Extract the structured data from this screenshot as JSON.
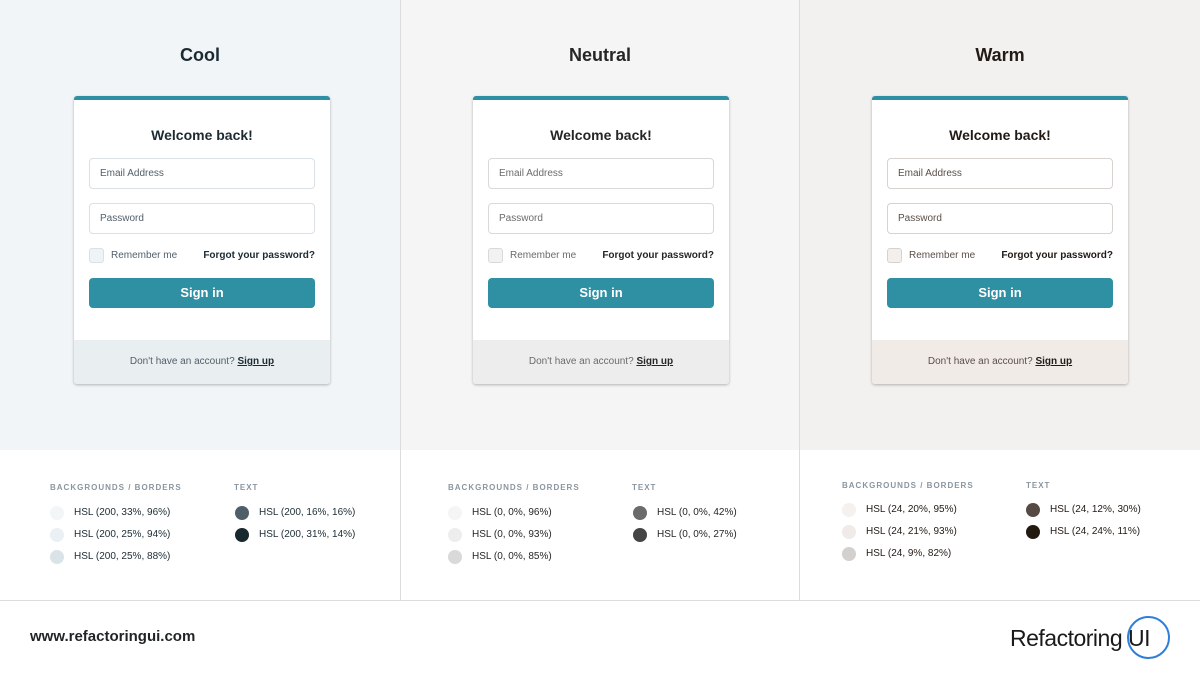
{
  "columns": {
    "cool": {
      "title": "Cool",
      "colors": {
        "page_bg": "#f1f5f8",
        "input_border": "#d9e1e6",
        "footer_bg": "#e9eef1",
        "checkbox_bg": "#eef3f6",
        "text_primary": "#1c2b33",
        "text_secondary": "#52606b"
      },
      "card": {
        "title": "Welcome back!",
        "email_placeholder": "Email Address",
        "password_placeholder": "Password",
        "remember_label": "Remember me",
        "forgot_label": "Forgot your password?",
        "signin_label": "Sign in",
        "footer_text": "Don't have an account?",
        "signup_label": "Sign up"
      },
      "legend": {
        "bg_heading": "BACKGROUNDS / BORDERS",
        "text_heading": "TEXT",
        "bg_swatches": [
          {
            "label": "HSL (200, 33%, 96%)",
            "color": "#f2f6f8"
          },
          {
            "label": "HSL (200, 25%, 94%)",
            "color": "#eaf0f3"
          },
          {
            "label": "HSL (200, 25%, 88%)",
            "color": "#d9e3e8"
          }
        ],
        "text_swatches": [
          {
            "label": "HSL (200, 16%, 16%)",
            "color": "#4d5f69"
          },
          {
            "label": "HSL (200, 31%, 14%)",
            "color": "#18282f"
          }
        ]
      }
    },
    "neutral": {
      "title": "Neutral",
      "colors": {
        "page_bg": "#f5f5f5",
        "input_border": "#d9d9d9",
        "footer_bg": "#ededed",
        "checkbox_bg": "#f2f2f2",
        "text_primary": "#262626",
        "text_secondary": "#6b6b6b"
      },
      "card": {
        "title": "Welcome back!",
        "email_placeholder": "Email Address",
        "password_placeholder": "Password",
        "remember_label": "Remember me",
        "forgot_label": "Forgot your password?",
        "signin_label": "Sign in",
        "footer_text": "Don't have an account?",
        "signup_label": "Sign up"
      },
      "legend": {
        "bg_heading": "BACKGROUNDS / BORDERS",
        "text_heading": "TEXT",
        "bg_swatches": [
          {
            "label": "HSL (0, 0%, 96%)",
            "color": "#f5f5f5"
          },
          {
            "label": "HSL (0, 0%, 93%)",
            "color": "#ededed"
          },
          {
            "label": "HSL (0, 0%, 85%)",
            "color": "#d9d9d9"
          }
        ],
        "text_swatches": [
          {
            "label": "HSL (0, 0%, 42%)",
            "color": "#6b6b6b"
          },
          {
            "label": "HSL (0, 0%, 27%)",
            "color": "#454545"
          }
        ]
      }
    },
    "warm": {
      "title": "Warm",
      "colors": {
        "page_bg": "#f3f1ef",
        "input_border": "#d7d2ce",
        "footer_bg": "#f1ebe8",
        "checkbox_bg": "#f3efec",
        "text_primary": "#221a15",
        "text_secondary": "#5a4f48"
      },
      "card": {
        "title": "Welcome back!",
        "email_placeholder": "Email Address",
        "password_placeholder": "Password",
        "remember_label": "Remember me",
        "forgot_label": "Forgot your password?",
        "signin_label": "Sign in",
        "footer_text": "Don't have an account?",
        "signup_label": "Sign up"
      },
      "legend": {
        "bg_heading": "BACKGROUNDS / BORDERS",
        "text_heading": "TEXT",
        "bg_swatches": [
          {
            "label": "HSL (24, 20%, 95%)",
            "color": "#f4f1ef"
          },
          {
            "label": "HSL (24, 21%, 93%)",
            "color": "#f0ebe8"
          },
          {
            "label": "HSL (24, 9%, 82%)",
            "color": "#d4d0cd"
          }
        ],
        "text_swatches": [
          {
            "label": "HSL (24, 12%, 30%)",
            "color": "#564b44"
          },
          {
            "label": "HSL (24, 24%, 11%)",
            "color": "#23190f"
          }
        ]
      }
    }
  },
  "accent": "#2f8fa3",
  "footer": {
    "site": "www.refactoringui.com",
    "brand": "Refactoring UI"
  }
}
